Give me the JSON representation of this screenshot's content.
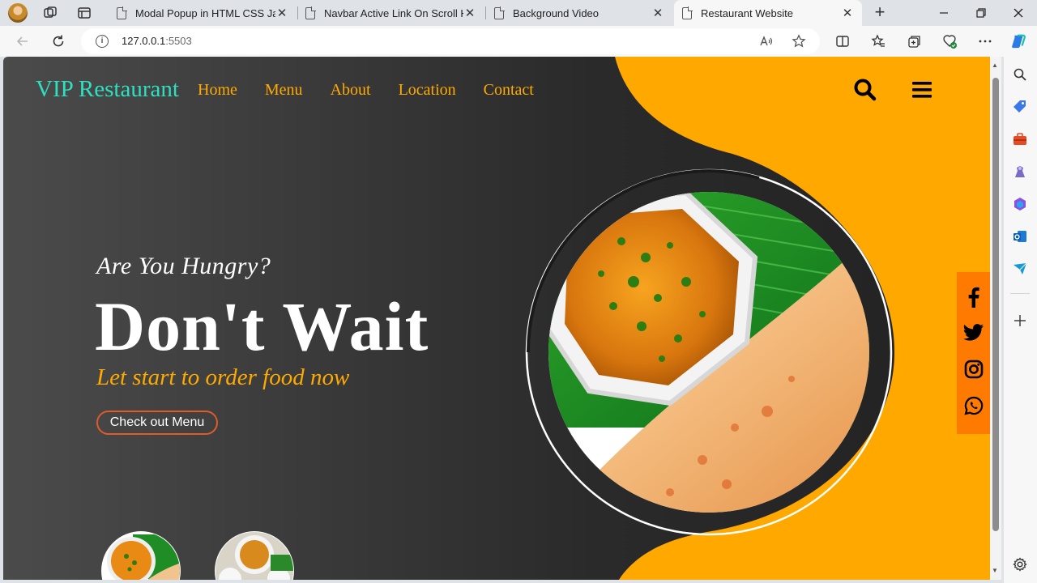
{
  "browser": {
    "tabs": [
      {
        "title": "Modal Popup in HTML CSS Java",
        "active": false
      },
      {
        "title": "Navbar Active Link On Scroll HT",
        "active": false
      },
      {
        "title": "Background Video",
        "active": false
      },
      {
        "title": "Restaurant Website",
        "active": true
      }
    ],
    "close_glyph": "✕",
    "new_tab_glyph": "+",
    "url_host": "127.0.0.1",
    "url_port": ":5503"
  },
  "site": {
    "brand": "VIP Restaurant",
    "nav": [
      "Home",
      "Menu",
      "About",
      "Location",
      "Contact"
    ],
    "tagline": "Are You Hungry?",
    "headline": "Don't Wait",
    "subline": "Let start to order food now",
    "cta": "Check out Menu",
    "header_icons": [
      "search-icon",
      "hamburger-menu-icon"
    ],
    "social_icons": [
      "facebook-icon",
      "twitter-icon",
      "instagram-icon",
      "whatsapp-icon"
    ]
  },
  "colors": {
    "accent_orange": "#ffa800",
    "brand_teal": "#2ee0c0",
    "nav_orange": "#ffaa00",
    "cta_border": "#e05a2a",
    "social_bg": "#ff7a00",
    "dark_bg": "#2a2a2a"
  }
}
